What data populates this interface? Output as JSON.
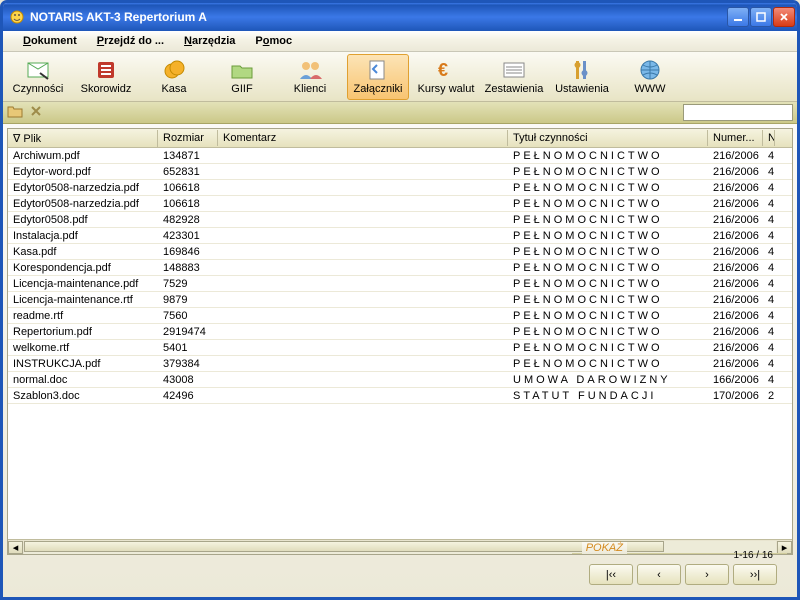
{
  "window": {
    "title": "NOTARIS AKT-3 Repertorium A"
  },
  "menu": {
    "items": [
      {
        "pre": "",
        "ul": "D",
        "post": "okument"
      },
      {
        "pre": "",
        "ul": "P",
        "post": "rzejdź do ..."
      },
      {
        "pre": "",
        "ul": "N",
        "post": "arzędzia"
      },
      {
        "pre": "P",
        "ul": "o",
        "post": "moc"
      }
    ]
  },
  "toolbar": {
    "items": [
      {
        "label": "Czynności",
        "name": "czynnosci"
      },
      {
        "label": "Skorowidz",
        "name": "skorowidz"
      },
      {
        "label": "Kasa",
        "name": "kasa"
      },
      {
        "label": "GIIF",
        "name": "giif"
      },
      {
        "label": "Klienci",
        "name": "klienci"
      },
      {
        "label": "Załączniki",
        "name": "zalaczniki",
        "active": true
      },
      {
        "label": "Kursy walut",
        "name": "kursy-walut"
      },
      {
        "label": "Zestawienia",
        "name": "zestawienia"
      },
      {
        "label": "Ustawienia",
        "name": "ustawienia"
      },
      {
        "label": "WWW",
        "name": "www"
      }
    ]
  },
  "grid": {
    "headers": {
      "plik": "∇ Plik",
      "rozmiar": "Rozmiar",
      "komentarz": "Komentarz",
      "tytul": "Tytuł czynności",
      "numer": "Numer..."
    },
    "rows": [
      {
        "plik": "Archiwum.pdf",
        "rozmiar": "134871",
        "kom": "",
        "tytul": "PEŁNOMOCNICTWO",
        "numer": "216/2006",
        "e": "4"
      },
      {
        "plik": "Edytor-word.pdf",
        "rozmiar": "652831",
        "kom": "",
        "tytul": "PEŁNOMOCNICTWO",
        "numer": "216/2006",
        "e": "4"
      },
      {
        "plik": "Edytor0508-narzedzia.pdf",
        "rozmiar": "106618",
        "kom": "",
        "tytul": "PEŁNOMOCNICTWO",
        "numer": "216/2006",
        "e": "4"
      },
      {
        "plik": "Edytor0508-narzedzia.pdf",
        "rozmiar": "106618",
        "kom": "",
        "tytul": "PEŁNOMOCNICTWO",
        "numer": "216/2006",
        "e": "4"
      },
      {
        "plik": "Edytor0508.pdf",
        "rozmiar": "482928",
        "kom": "",
        "tytul": "PEŁNOMOCNICTWO",
        "numer": "216/2006",
        "e": "4"
      },
      {
        "plik": "Instalacja.pdf",
        "rozmiar": "423301",
        "kom": "",
        "tytul": "PEŁNOMOCNICTWO",
        "numer": "216/2006",
        "e": "4"
      },
      {
        "plik": "Kasa.pdf",
        "rozmiar": "169846",
        "kom": "",
        "tytul": "PEŁNOMOCNICTWO",
        "numer": "216/2006",
        "e": "4"
      },
      {
        "plik": "Korespondencja.pdf",
        "rozmiar": "148883",
        "kom": "",
        "tytul": "PEŁNOMOCNICTWO",
        "numer": "216/2006",
        "e": "4"
      },
      {
        "plik": "Licencja-maintenance.pdf",
        "rozmiar": "7529",
        "kom": "",
        "tytul": "PEŁNOMOCNICTWO",
        "numer": "216/2006",
        "e": "4"
      },
      {
        "plik": "Licencja-maintenance.rtf",
        "rozmiar": "9879",
        "kom": "",
        "tytul": "PEŁNOMOCNICTWO",
        "numer": "216/2006",
        "e": "4"
      },
      {
        "plik": "readme.rtf",
        "rozmiar": "7560",
        "kom": "",
        "tytul": "PEŁNOMOCNICTWO",
        "numer": "216/2006",
        "e": "4"
      },
      {
        "plik": "Repertorium.pdf",
        "rozmiar": "2919474",
        "kom": "",
        "tytul": "PEŁNOMOCNICTWO",
        "numer": "216/2006",
        "e": "4"
      },
      {
        "plik": "welkome.rtf",
        "rozmiar": "5401",
        "kom": "",
        "tytul": "PEŁNOMOCNICTWO",
        "numer": "216/2006",
        "e": "4"
      },
      {
        "plik": "INSTRUKCJA.pdf",
        "rozmiar": "379384",
        "kom": "",
        "tytul": "PEŁNOMOCNICTWO",
        "numer": "216/2006",
        "e": "4"
      },
      {
        "plik": "normal.doc",
        "rozmiar": "43008",
        "kom": "",
        "tytul": "UMOWA DAROWIZNY",
        "numer": "166/2006",
        "e": "4"
      },
      {
        "plik": "Szablon3.doc",
        "rozmiar": "42496",
        "kom": "",
        "tytul": "STATUT  FUNDACJI",
        "numer": "170/2006",
        "e": "2"
      }
    ]
  },
  "footer": {
    "label": "POKAŻ",
    "pageinfo": "1-16 / 16",
    "nav": {
      "first": "❙<<",
      "prev": "<",
      "next": ">",
      "last": ">>❙"
    }
  }
}
